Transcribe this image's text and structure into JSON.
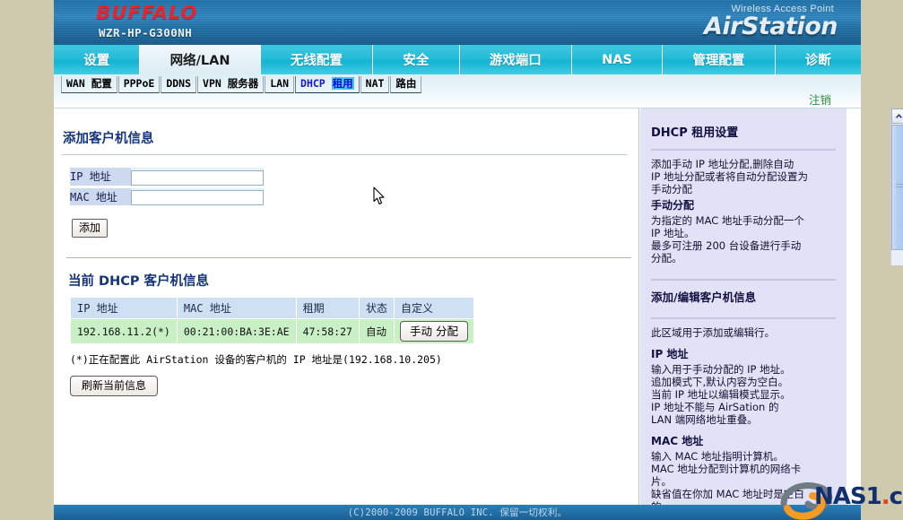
{
  "header": {
    "brand": "BUFFALO",
    "model": "WZR-HP-G300NH",
    "product_kind": "Wireless Access Point",
    "product_name": "AirStation"
  },
  "mainnav": {
    "tabs": [
      {
        "label": "设置",
        "active": false
      },
      {
        "label": "网络/LAN",
        "active": true
      },
      {
        "label": "无线配置",
        "active": false
      },
      {
        "label": "安全",
        "active": false
      },
      {
        "label": "游戏端口",
        "active": false
      },
      {
        "label": "NAS",
        "active": false
      },
      {
        "label": "管理配置",
        "active": false
      },
      {
        "label": "诊断",
        "active": false
      }
    ]
  },
  "subnav": {
    "items": [
      {
        "label": "WAN 配置",
        "active": false
      },
      {
        "label": "PPPoE",
        "active": false
      },
      {
        "label": "DDNS",
        "active": false
      },
      {
        "label": "VPN 服务器",
        "active": false
      },
      {
        "label": "LAN",
        "active": false
      },
      {
        "label": "DHCP 租用",
        "active": true
      },
      {
        "label": "NAT",
        "active": false
      },
      {
        "label": "路由",
        "active": false
      }
    ],
    "logout_label": "注销"
  },
  "main": {
    "add_section_title": "添加客户机信息",
    "fields": [
      {
        "label": "IP 地址",
        "value": "",
        "placeholder": ""
      },
      {
        "label": "MAC 地址",
        "value": "",
        "placeholder": ""
      }
    ],
    "add_button_label": "添加",
    "table_section_title": "当前 DHCP 客户机信息",
    "table": {
      "columns": [
        "IP 地址",
        "MAC 地址",
        "租期",
        "状态",
        "自定义"
      ],
      "rows": [
        {
          "ip": "192.168.11.2(*)",
          "mac": "00:21:00:BA:3E:AE",
          "lease": "47:58:27",
          "state": "自动",
          "action_label": "手动 分配"
        }
      ]
    },
    "table_note": "(*)正在配置此 AirStation 设备的客户机的 IP 地址是(192.168.10.205)",
    "refresh_button_label": "刷新当前信息"
  },
  "help": {
    "title": "DHCP 租用设置",
    "intro": "添加手动 IP 地址分配,删除自动\nIP 地址分配或者将自动分配设置为\n手动分配",
    "manual_heading": "手动分配",
    "manual_body": "为指定的 MAC 地址手动分配一个\nIP 地址。\n最多可注册 200 台设备进行手动\n分配。",
    "section2_title": "添加/编辑客户机信息",
    "section2_intro": "此区域用于添加或编辑行。",
    "ip_heading": "IP 地址",
    "ip_body": "输入用于手动分配的 IP 地址。\n追加模式下,默认内容为空白。\n当前 IP 地址以编辑模式显示。\nIP 地址不能与 AirSation 的\nLAN 端网络地址重叠。",
    "mac_heading": "MAC 地址",
    "mac_body": "输入 MAC 地址指明计算机。\nMAC 地址分配到计算机的网络卡\n片。\n缺省值在你加 MAC 地址时是空白\n的。"
  },
  "footer": {
    "copyright": "(C)2000-2009 BUFFALO INC. 保留一切权利。"
  },
  "watermark": {
    "text": "NAS1",
    "dot": ".",
    "tld": "cn"
  },
  "colors": {
    "page_margin": "#cfc9ad",
    "banner_blue": "#1f74ab",
    "brand_red": "#ec1c24",
    "tab_cyan": "#25bcd8",
    "tab_active": "#e4f1f6",
    "subnav_active_text": "#1616e0",
    "subnav_highlight": "#4ac3f0",
    "logout_green": "#2f8f3f",
    "help_bg": "#e2e2f7",
    "label_bg": "#ccd9ef",
    "row_green": "#c9f0c4",
    "header_row_blue": "#cfe0f2",
    "footer_blue": "#1b6094",
    "watermark_navy": "#12306e",
    "watermark_orange": "#d94a18"
  }
}
